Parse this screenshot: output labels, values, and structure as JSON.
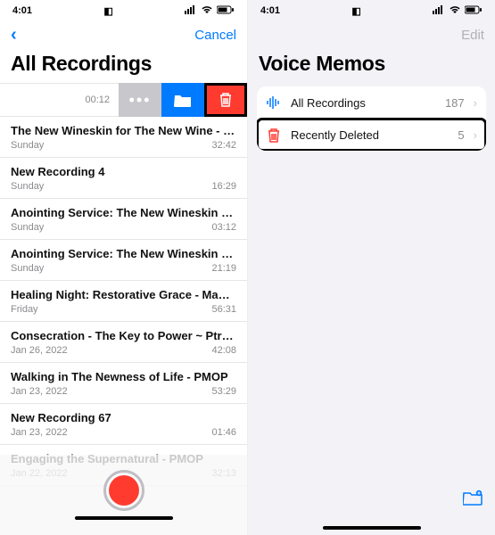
{
  "status": {
    "time": "4:01",
    "orientation_glyph": "◧"
  },
  "left": {
    "nav": {
      "back_glyph": "‹",
      "cancel": "Cancel"
    },
    "title": "All Recordings",
    "swipe": {
      "time": "00:12",
      "more": "•••"
    },
    "items": [
      {
        "title": "The New Wineskin for The New Wine - PMOP...",
        "date": "Sunday",
        "dur": "32:42"
      },
      {
        "title": "New Recording 4",
        "date": "Sunday",
        "dur": "16:29"
      },
      {
        "title": "Anointing Service: The New Wineskin for the...",
        "date": "Sunday",
        "dur": "03:12"
      },
      {
        "title": "Anointing Service: The New Wineskin for The...",
        "date": "Sunday",
        "dur": "21:19"
      },
      {
        "title": "Healing Night: Restorative Grace - Madam Ar...",
        "date": "Friday",
        "dur": "56:31"
      },
      {
        "title": "Consecration - The Key to Power ~ Ptra. Luna",
        "date": "Jan 26, 2022",
        "dur": "42:08"
      },
      {
        "title": "Walking in The Newness of Life - PMOP",
        "date": "Jan 23, 2022",
        "dur": "53:29"
      },
      {
        "title": "New Recording 67",
        "date": "Jan 23, 2022",
        "dur": "01:46"
      },
      {
        "title": "Engaging the Supernatural - PMOP",
        "date": "Jan 22, 2022",
        "dur": "32:13"
      }
    ]
  },
  "right": {
    "nav": {
      "edit": "Edit"
    },
    "title": "Voice Memos",
    "folders": [
      {
        "icon": "waveform",
        "label": "All Recordings",
        "count": "187"
      },
      {
        "icon": "trash",
        "label": "Recently Deleted",
        "count": "5"
      }
    ]
  }
}
